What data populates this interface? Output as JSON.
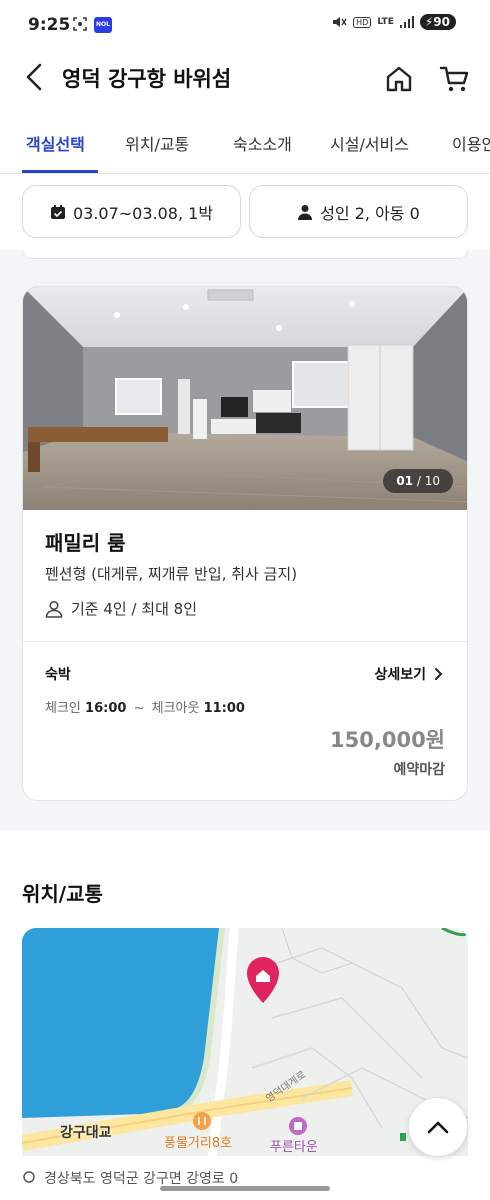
{
  "status_bar": {
    "time": "9:25",
    "app_badge": "NOL",
    "network": "LTE",
    "battery": "90",
    "icons": [
      "screenshot-icon",
      "app-badge-icon",
      "mute-icon",
      "hd-voice-icon",
      "signal-icon",
      "battery-icon"
    ]
  },
  "header": {
    "title": "영덕 강구항 바위섬",
    "back_icon": "chevron-left-icon",
    "home_icon": "home-icon",
    "cart_icon": "cart-icon"
  },
  "tabs": [
    {
      "label": "객실선택",
      "active": true
    },
    {
      "label": "위치/교통",
      "active": false
    },
    {
      "label": "숙소소개",
      "active": false
    },
    {
      "label": "시설/서비스",
      "active": false
    },
    {
      "label": "이용안",
      "active": false
    }
  ],
  "filters": {
    "date": "03.07~03.08, 1박",
    "guests": "성인 2, 아동 0",
    "date_icon": "calendar-icon",
    "guests_icon": "person-icon"
  },
  "room": {
    "photo_counter_current": "01",
    "photo_counter_total": "/ 10",
    "name": "패밀리 룸",
    "description": "펜션형 (대게류, 찌개류 반입, 취사 금지)",
    "capacity": "기준 4인 / 최대 8인",
    "stay_type": "숙박",
    "detail_link": "상세보기",
    "checkin_label": "체크인",
    "checkin_time": "16:00",
    "separator": "~",
    "checkout_label": "체크아웃",
    "checkout_time": "11:00",
    "price": "150,000원",
    "booking_status": "예약마감"
  },
  "location": {
    "title": "위치/교통",
    "map_labels": {
      "bridge": "강구대교",
      "restaurant": "풍물거리8호",
      "apartment": "푸른타운",
      "road": "영덕대게로"
    },
    "address_partial": "경상북도 영덕군 강구면 강영로 0"
  },
  "colors": {
    "accent": "#2b45c8",
    "pin": "#e0245e",
    "water": "#2e9fd8",
    "price_gray": "#888888"
  }
}
